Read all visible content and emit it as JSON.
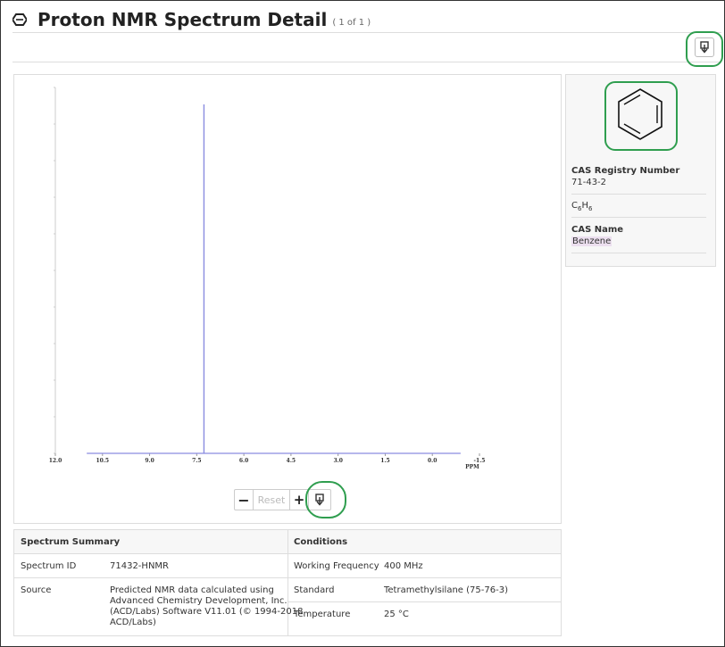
{
  "header": {
    "title": "Proton NMR Spectrum Detail",
    "count": "( 1 of 1 )"
  },
  "chart_data": {
    "type": "line",
    "xlabel": "PPM",
    "x_ticks": [
      "12.0",
      "10.5",
      "9.0",
      "7.5",
      "6.0",
      "4.5",
      "3.0",
      "1.5",
      "0.0",
      "-1.5"
    ],
    "xlim": [
      12.0,
      -1.5
    ],
    "peaks": [
      {
        "x": 7.27,
        "intensity": 1.0
      }
    ],
    "baseline_range": [
      11.0,
      -0.9
    ],
    "line_color": "#8a8ce0"
  },
  "controls": {
    "minus": "−",
    "reset": "Reset",
    "plus": "+"
  },
  "compound": {
    "cas_label": "CAS Registry Number",
    "cas_value": "71-43-2",
    "formula_c": "C",
    "formula_c_sub": "6",
    "formula_h": "H",
    "formula_h_sub": "6",
    "name_label": "CAS Name",
    "name_value": "Benzene"
  },
  "summary": {
    "heading": "Spectrum Summary",
    "rows": [
      {
        "label": "Spectrum ID",
        "value": "71432-HNMR"
      },
      {
        "label": "Source",
        "value_lines": [
          "Predicted NMR data calculated using",
          "Advanced Chemistry Development, Inc.",
          "(ACD/Labs) Software V11.01 (© 1994-2018",
          "ACD/Labs)"
        ]
      }
    ]
  },
  "conditions": {
    "heading": "Conditions",
    "rows": [
      {
        "label": "Working Frequency",
        "value": "400 MHz"
      },
      {
        "label": "Standard",
        "value": "Tetramethylsilane (75-76-3)"
      },
      {
        "label": "Temperature",
        "value": "25 °C"
      }
    ]
  }
}
